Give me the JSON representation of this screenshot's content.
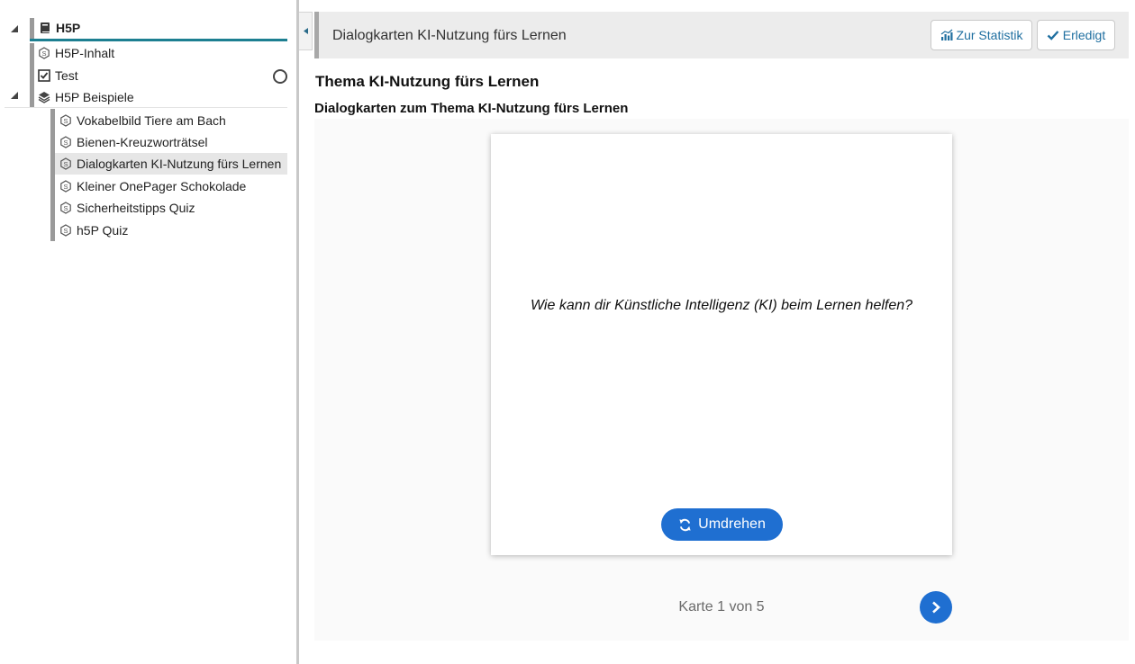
{
  "sidebar": {
    "root": {
      "label": "H5P"
    },
    "items": [
      {
        "label": "H5P-Inhalt",
        "icon": "h5p-icon"
      },
      {
        "label": "Test",
        "icon": "checkbox-icon",
        "status": "not-done-circle-icon"
      },
      {
        "label": "H5P Beispiele",
        "icon": "layers-icon"
      }
    ],
    "children": [
      {
        "label": "Vokabelbild Tiere am Bach",
        "icon": "h5p-icon"
      },
      {
        "label": "Bienen-Kreuzworträtsel",
        "icon": "h5p-icon"
      },
      {
        "label": "Dialogkarten KI-Nutzung fürs Lernen",
        "icon": "h5p-icon",
        "selected": true
      },
      {
        "label": "Kleiner OnePager Schokolade",
        "icon": "h5p-icon"
      },
      {
        "label": "Sicherheitstipps Quiz",
        "icon": "h5p-icon"
      },
      {
        "label": "h5P Quiz",
        "icon": "h5p-icon"
      }
    ]
  },
  "header": {
    "title": "Dialogkarten KI-Nutzung fürs Lernen",
    "stats_button": "Zur Statistik",
    "done_button": "Erledigt"
  },
  "main": {
    "page_title": "Thema KI-Nutzung fürs Lernen",
    "content_title": "Dialogkarten zum Thema KI-Nutzung fürs Lernen",
    "card": {
      "question": "Wie kann dir Künstliche Intelligenz (KI) beim Lernen helfen?",
      "flip_button": "Umdrehen"
    },
    "progress_text": "Karte 1 von 5"
  },
  "colors": {
    "accent_teal": "#1d7f91",
    "button_blue": "#1f6fd1",
    "link_blue": "#1f6fa0"
  }
}
